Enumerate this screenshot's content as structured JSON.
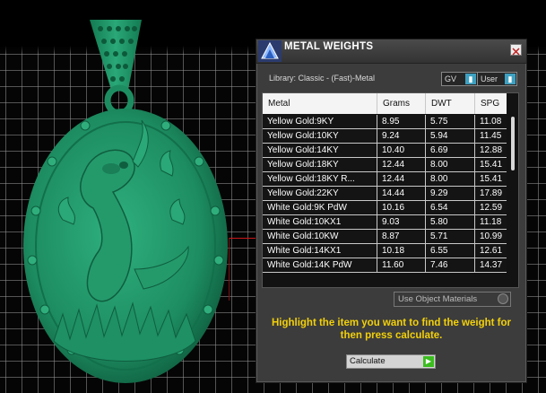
{
  "panel": {
    "title": "METAL WEIGHTS",
    "close_icon": "close-icon",
    "library_label": "Library: Classic - (Fast)-Metal",
    "gv_label": "GV",
    "user_label": "User",
    "table": {
      "headers": [
        "Metal",
        "Grams",
        "DWT",
        "SPG"
      ],
      "rows": [
        {
          "metal": "Yellow Gold:9KY",
          "grams": "8.95",
          "dwt": "5.75",
          "spg": "11.08"
        },
        {
          "metal": "Yellow Gold:10KY",
          "grams": "9.24",
          "dwt": "5.94",
          "spg": "11.45"
        },
        {
          "metal": "Yellow Gold:14KY",
          "grams": "10.40",
          "dwt": "6.69",
          "spg": "12.88"
        },
        {
          "metal": "Yellow Gold:18KY",
          "grams": "12.44",
          "dwt": "8.00",
          "spg": "15.41"
        },
        {
          "metal": "Yellow Gold:18KY R...",
          "grams": "12.44",
          "dwt": "8.00",
          "spg": "15.41"
        },
        {
          "metal": "Yellow Gold:22KY",
          "grams": "14.44",
          "dwt": "9.29",
          "spg": "17.89"
        },
        {
          "metal": "White Gold:9K PdW",
          "grams": "10.16",
          "dwt": "6.54",
          "spg": "12.59"
        },
        {
          "metal": "White Gold:10KX1",
          "grams": "9.03",
          "dwt": "5.80",
          "spg": "11.18"
        },
        {
          "metal": "White Gold:10KW",
          "grams": "8.87",
          "dwt": "5.71",
          "spg": "10.99"
        },
        {
          "metal": "White Gold:14KX1",
          "grams": "10.18",
          "dwt": "6.55",
          "spg": "12.61"
        },
        {
          "metal": "White Gold:14K PdW",
          "grams": "11.60",
          "dwt": "7.46",
          "spg": "14.37"
        }
      ]
    },
    "use_object_materials": "Use Object Materials",
    "instruction": "Highlight the item you want to find the weight for then press calculate.",
    "calculate_label": "Calculate"
  },
  "colors": {
    "model_green": "#1f9a6a",
    "instruction_yellow": "#f2d00a",
    "calc_arrow_green": "#3bbd1f",
    "dropdown_arrow_blue": "#3ea0c0"
  }
}
